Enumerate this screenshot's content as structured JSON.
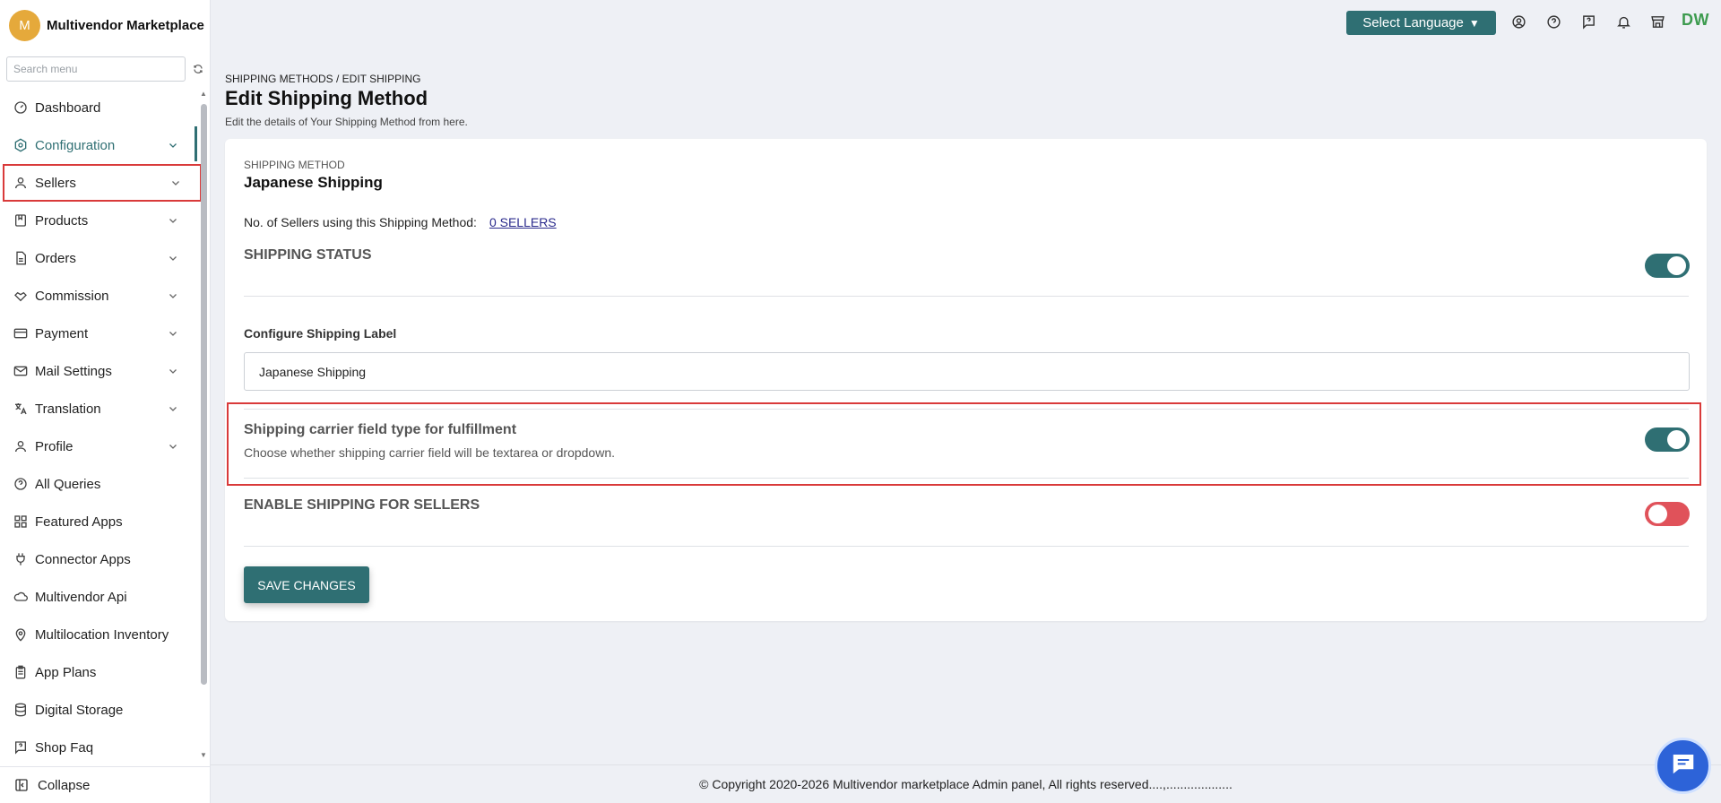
{
  "brand": {
    "avatar_letter": "M",
    "name": "Multivendor Marketplace"
  },
  "sidebar": {
    "search_placeholder": "Search menu",
    "items": [
      {
        "label": "Dashboard",
        "icon": "gauge-icon",
        "has_children": false
      },
      {
        "label": "Configuration",
        "icon": "settings-hex-icon",
        "has_children": true,
        "active": true
      },
      {
        "label": "Sellers",
        "icon": "user-icon",
        "has_children": true,
        "highlighted": true
      },
      {
        "label": "Products",
        "icon": "bookmark-box-icon",
        "has_children": true
      },
      {
        "label": "Orders",
        "icon": "document-icon",
        "has_children": true
      },
      {
        "label": "Commission",
        "icon": "handshake-icon",
        "has_children": true
      },
      {
        "label": "Payment",
        "icon": "card-icon",
        "has_children": true
      },
      {
        "label": "Mail Settings",
        "icon": "mail-icon",
        "has_children": true
      },
      {
        "label": "Translation",
        "icon": "translate-icon",
        "has_children": true
      },
      {
        "label": "Profile",
        "icon": "user-icon",
        "has_children": true
      },
      {
        "label": "All Queries",
        "icon": "question-circle-icon",
        "has_children": false
      },
      {
        "label": "Featured Apps",
        "icon": "apps-grid-icon",
        "has_children": false
      },
      {
        "label": "Connector Apps",
        "icon": "plug-icon",
        "has_children": false
      },
      {
        "label": "Multivendor Api",
        "icon": "cloud-icon",
        "has_children": false
      },
      {
        "label": "Multilocation Inventory",
        "icon": "location-pin-icon",
        "has_children": false
      },
      {
        "label": "App Plans",
        "icon": "clipboard-icon",
        "has_children": false
      },
      {
        "label": "Digital Storage",
        "icon": "database-icon",
        "has_children": false
      },
      {
        "label": "Shop Faq",
        "icon": "faq-bubble-icon",
        "has_children": false
      }
    ],
    "collapse_label": "Collapse"
  },
  "topbar": {
    "language_label": "Select Language",
    "icons": [
      "account-icon",
      "help-icon",
      "faq-icon",
      "bell-icon",
      "store-icon"
    ],
    "initials": "DW"
  },
  "page": {
    "breadcrumb": "SHIPPING METHODS / EDIT SHIPPING",
    "title": "Edit Shipping Method",
    "subtitle": "Edit the details of Your Shipping Method from here."
  },
  "card": {
    "method_label": "SHIPPING METHOD",
    "method_name": "Japanese Shipping",
    "sellers_text": "No. of Sellers using this Shipping Method:",
    "sellers_link": "0 SELLERS",
    "shipping_status_title": "SHIPPING STATUS",
    "shipping_status_on": true,
    "label_field_title": "Configure Shipping Label",
    "label_field_value": "Japanese Shipping",
    "carrier_title": "Shipping carrier field type for fulfillment",
    "carrier_desc": "Choose whether shipping carrier field will be textarea or dropdown.",
    "carrier_on": true,
    "enable_sellers_title": "ENABLE SHIPPING FOR SELLERS",
    "enable_sellers_on": false,
    "save_label": "SAVE CHANGES"
  },
  "footer": {
    "text": "© Copyright 2020-2026 Multivendor marketplace Admin panel, All rights reserved....,..................."
  },
  "colors": {
    "primary": "#2f6f73",
    "danger": "#e0525a",
    "highlight": "#d93a3a",
    "chat": "#2d63d8"
  }
}
